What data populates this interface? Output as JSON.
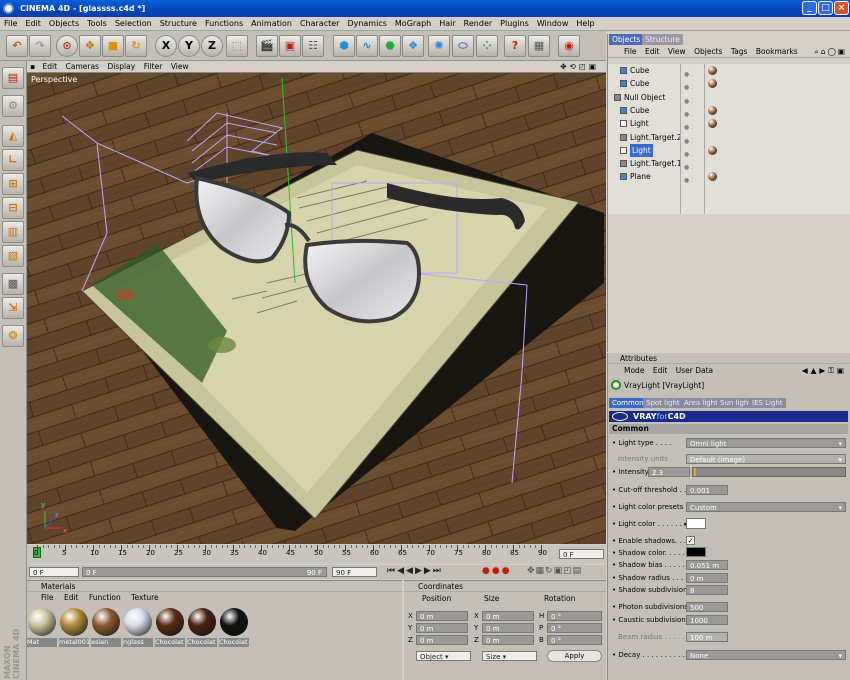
{
  "window": {
    "title": "CINEMA 4D - [glassss.c4d *]"
  },
  "menu": [
    "File",
    "Edit",
    "Objects",
    "Tools",
    "Selection",
    "Structure",
    "Functions",
    "Animation",
    "Character",
    "Dynamics",
    "MoGraph",
    "Hair",
    "Render",
    "Plugins",
    "Window",
    "Help"
  ],
  "toolbar": {
    "x_label": "X",
    "y_label": "Y",
    "z_label": "Z"
  },
  "viewport": {
    "menu": [
      "Edit",
      "Cameras",
      "Display",
      "Filter",
      "View"
    ],
    "label": "Perspective",
    "axis_x": "x",
    "axis_y": "y",
    "axis_z": "z"
  },
  "timeline": {
    "ticks": [
      "0",
      "5",
      "10",
      "15",
      "20",
      "25",
      "30",
      "35",
      "40",
      "45",
      "50",
      "55",
      "60",
      "65",
      "70",
      "75",
      "80",
      "85",
      "90"
    ],
    "current_frame": "0 F",
    "start": "0 F",
    "min": "0 F",
    "max": "90 F",
    "end": "90 F"
  },
  "materials": {
    "title": "Materials",
    "menu": [
      "File",
      "Edit",
      "Function",
      "Texture"
    ],
    "items": [
      {
        "label": "Mat",
        "color": "#c8c4a0"
      },
      {
        "label": "metal001",
        "color": "#b08a3c"
      },
      {
        "label": "asian",
        "color": "#8a5a30"
      },
      {
        "label": "nglass",
        "color": "#d8dce8"
      },
      {
        "label": "Chocolat",
        "color": "#5a2a14"
      },
      {
        "label": "Chocolat",
        "color": "#4a2010"
      },
      {
        "label": "Chocolat",
        "color": "#101010"
      }
    ]
  },
  "coordinates": {
    "title": "Coordinates",
    "headers": [
      "Position",
      "Size",
      "Rotation"
    ],
    "rows": [
      {
        "axis": "X",
        "pos": "0 m",
        "size_axis": "X",
        "size": "0 m",
        "rot_axis": "H",
        "rot": "0 °"
      },
      {
        "axis": "Y",
        "pos": "0 m",
        "size_axis": "Y",
        "size": "0 m",
        "rot_axis": "P",
        "rot": "0 °"
      },
      {
        "axis": "Z",
        "pos": "0 m",
        "size_axis": "Z",
        "size": "0 m",
        "rot_axis": "B",
        "rot": "0 °"
      }
    ],
    "mode1": "Object",
    "mode2": "Size",
    "apply": "Apply"
  },
  "objects": {
    "tabs": [
      "Objects",
      "Structure"
    ],
    "menu": [
      "File",
      "Edit",
      "View",
      "Objects",
      "Tags",
      "Bookmarks"
    ],
    "items": [
      {
        "name": "Cube",
        "indent": 1,
        "icon_color": "#3a8ad8"
      },
      {
        "name": "Cube",
        "indent": 1,
        "icon_color": "#3a8ad8"
      },
      {
        "name": "Null Object",
        "indent": 0,
        "icon_color": "#888888"
      },
      {
        "name": "Cube",
        "indent": 1,
        "icon_color": "#3a8ad8"
      },
      {
        "name": "Light",
        "indent": 1,
        "icon_color": "#ffffff"
      },
      {
        "name": "Light.Target.2",
        "indent": 1,
        "icon_color": "#888888"
      },
      {
        "name": "Light",
        "indent": 1,
        "icon_color": "#ffffff",
        "selected": true
      },
      {
        "name": "Light.Target.1",
        "indent": 1,
        "icon_color": "#888888"
      },
      {
        "name": "Plane",
        "indent": 1,
        "icon_color": "#3a8ad8"
      }
    ]
  },
  "attributes": {
    "title": "Attributes",
    "menu": [
      "Mode",
      "Edit",
      "User Data"
    ],
    "object": "VrayLight [VrayLight]",
    "tabs": [
      "Common",
      "Spot light",
      "Area light",
      "Sun light",
      "IES Light"
    ],
    "banner": "VRAYforC4D",
    "banner_v": "VRAY",
    "banner_for": "for",
    "banner_c4d": "C4D",
    "section": "Common",
    "light_type_label": "Light type . . . .",
    "light_type": "Omni light",
    "intensity_units_label": "Intensity units",
    "intensity_units": "Default (image)",
    "intensity_label": "Intensity",
    "intensity": "2.3",
    "cutoff_label": "Cut-off threshold . . . .",
    "cutoff": "0.001",
    "color_presets_label": "Light color presets . .",
    "color_presets": "Custom",
    "light_color_label": "Light color . . . . . .",
    "enable_shadows_label": "Enable shadows. . .",
    "shadow_color_label": "Shadow color. . . . .",
    "shadow_bias_label": "Shadow bias . . . . .",
    "shadow_bias": "0.051 m",
    "shadow_radius_label": "Shadow radius . . . .",
    "shadow_radius": "0 m",
    "shadow_subdiv_label": "Shadow subdivisions",
    "shadow_subdiv": "8",
    "photon_label": "Photon subdivisions",
    "photon": "500",
    "caustic_label": "Caustic subdivisions",
    "caustic": "1000",
    "beam_label": "Beam radius . . . . . .",
    "beam": "100 m",
    "decay_label": "Decay . . . . . . . . . .",
    "decay": "None"
  },
  "logo": {
    "line1": "MAXON",
    "line2": "CINEMA 4D"
  }
}
